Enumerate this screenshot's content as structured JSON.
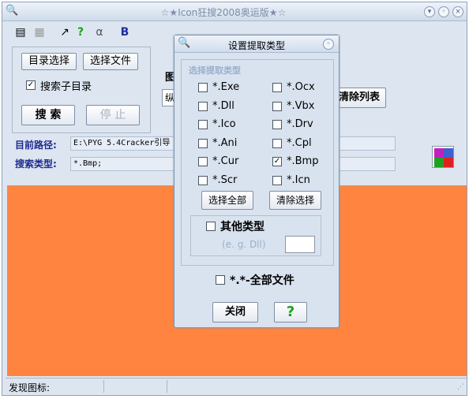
{
  "window": {
    "title": "☆★Icon狂搜2008奥运版★☆"
  },
  "toolbar": {
    "icons": [
      "book-icon",
      "grid-icon",
      "wand-icon",
      "help-icon",
      "alpha-icon",
      "b-icon"
    ]
  },
  "left": {
    "dir_select_label": "目录选择",
    "file_select_label": "选择文件",
    "search_subdir_label": "搜索子目录",
    "search_label": "搜 索",
    "stop_label": "停 止",
    "path_label": "目前路径:",
    "path_value": "E:\\PYG 5.4Cracker引导",
    "type_label": "搜索类型:",
    "type_value": "*.Bmp;",
    "partial_label": "图",
    "partial_select": "纵",
    "clear_list_label": "清除列表"
  },
  "status": {
    "found_label": "发现图标:"
  },
  "dialog": {
    "title": "设置提取类型",
    "group_label": "选择提取类型",
    "left_types": [
      "*.Exe",
      "*.Dll",
      "*.Ico",
      "*.Ani",
      "*.Cur",
      "*.Scr"
    ],
    "right_types": [
      "*.Ocx",
      "*.Vbx",
      "*.Drv",
      "*.Cpl",
      "*.Bmp",
      "*.Icn"
    ],
    "checked": [
      "*.Bmp"
    ],
    "select_all_label": "选择全部",
    "clear_select_label": "清除选择",
    "other_label": "其他类型",
    "other_placeholder": "(e. g. Dll)",
    "all_files_label": "*.*-全部文件",
    "close_label": "关闭",
    "help_label": "?"
  }
}
